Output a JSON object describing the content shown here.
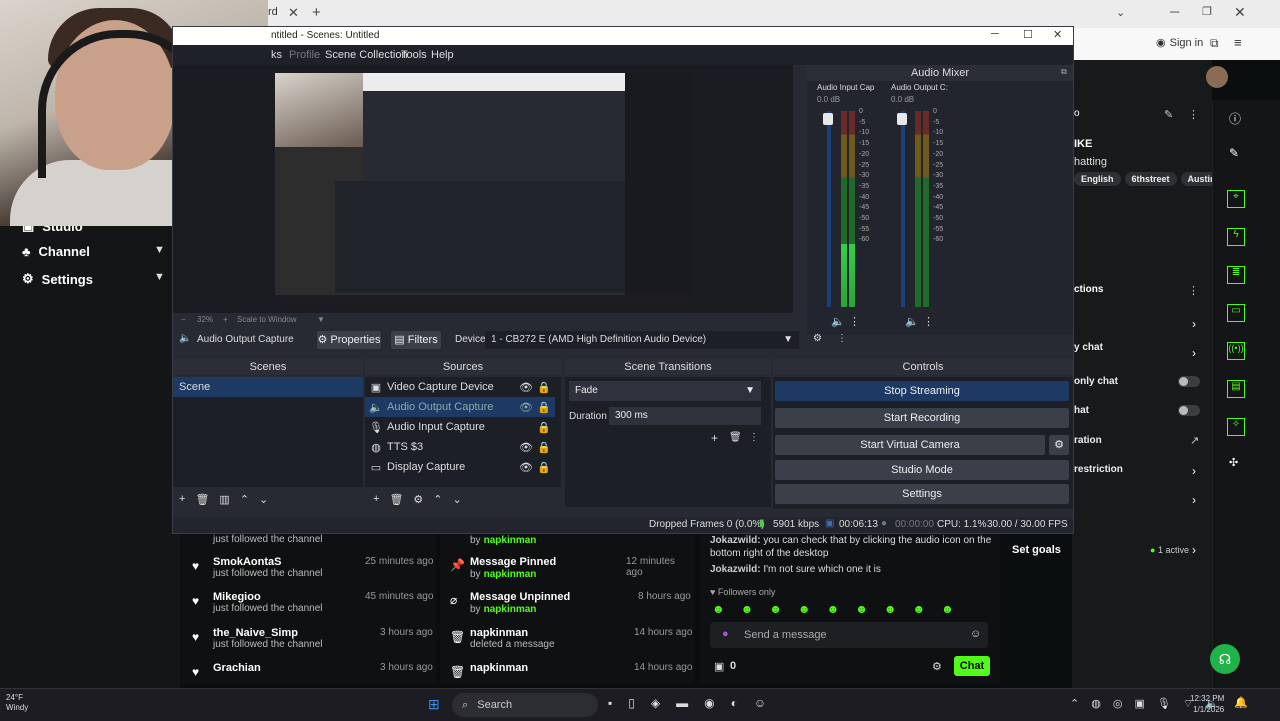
{
  "browser": {
    "signin": "Sign in",
    "tab_title": "rd"
  },
  "kick_left": {
    "items": [
      {
        "label": "Studio"
      },
      {
        "label": "Channel"
      },
      {
        "label": "Settings"
      }
    ]
  },
  "kick_right": {
    "title_partial": "IKE",
    "sub_partial": "hatting",
    "tags": [
      "English",
      "6thstreet",
      "Austin"
    ],
    "section_label": "ctions",
    "rows": [
      "y chat",
      "only chat",
      "hat",
      "ration",
      "restriction"
    ],
    "goals_label": "Set goals",
    "goals_status": "1 active"
  },
  "obs": {
    "title": "ntitled - Scenes: Untitled",
    "menu": [
      "ks",
      "Profile",
      "Scene Collection",
      "Tools",
      "Help"
    ],
    "zoom": "32%",
    "scale_label": "Scale to Window",
    "source_bar": {
      "selected_source": "Audio Output Capture",
      "properties": "Properties",
      "filters": "Filters",
      "device_label": "Device",
      "device_value": "1 - CB272 E (AMD High Definition Audio Device)"
    },
    "mixer": {
      "title": "Audio Mixer",
      "channels": [
        {
          "name": "Audio Input Cap",
          "db": "0.0 dB",
          "level": 0.32
        },
        {
          "name": "Audio Output C:",
          "db": "0.0 dB",
          "level": 0.0
        }
      ],
      "scale": [
        "0",
        "-5",
        "-10",
        "-15",
        "-20",
        "-25",
        "-30",
        "-35",
        "-40",
        "-45",
        "-50",
        "-55",
        "-60"
      ]
    },
    "scenes": {
      "title": "Scenes",
      "items": [
        "Scene"
      ]
    },
    "sources": {
      "title": "Sources",
      "items": [
        "Video Capture Device",
        "Audio Output Capture",
        "Audio Input Capture",
        "TTS $3",
        "Display Capture"
      ]
    },
    "transitions": {
      "title": "Scene Transitions",
      "type": "Fade",
      "duration_label": "Duration",
      "duration_value": "300 ms"
    },
    "controls": {
      "title": "Controls",
      "buttons": [
        "Stop Streaming",
        "Start Recording",
        "Start Virtual Camera",
        "Studio Mode",
        "Settings"
      ]
    },
    "status": {
      "dropped": "Dropped Frames 0 (0.0%)",
      "kbps": "5901 kbps",
      "stream_time": "00:06:13",
      "rec_time": "00:00:00",
      "cpu": "CPU: 1.1%",
      "fps": "30.00 / 30.00 FPS"
    }
  },
  "feed_left": [
    {
      "name": "",
      "sub": "just followed the channel",
      "time": ""
    },
    {
      "name": "SmokAontaS",
      "sub": "just followed the channel",
      "time": "25 minutes ago"
    },
    {
      "name": "Mikegioo",
      "sub": "just followed the channel",
      "time": "45 minutes ago"
    },
    {
      "name": "the_Naive_Simp",
      "sub": "just followed the channel",
      "time": "3 hours ago"
    },
    {
      "name": "Grachian",
      "sub": "just followed the channel",
      "time": "3 hours ago"
    }
  ],
  "feed_mid": [
    {
      "name": "",
      "by": "by",
      "who": "napkinman",
      "time": ""
    },
    {
      "name": "Message Pinned",
      "by": "by",
      "who": "napkinman",
      "time": "12 minutes ago"
    },
    {
      "name": "Message Unpinned",
      "by": "by",
      "who": "napkinman",
      "time": "8 hours ago"
    },
    {
      "name": "napkinman",
      "by": "",
      "who": "deleted a message",
      "time": "14 hours ago"
    },
    {
      "name": "napkinman",
      "by": "",
      "who": "",
      "time": "14 hours ago"
    }
  ],
  "chat": {
    "messages": [
      {
        "user": "Jokazwild:",
        "text": " you can check that by clicking the audio icon on the bottom right of the desktop"
      },
      {
        "user": "Jokazwild:",
        "text": " I'm not sure which one it is"
      }
    ],
    "followers_only": "Followers only",
    "placeholder": "Send a message",
    "count": "0",
    "chat_button": "Chat"
  },
  "taskbar": {
    "weather_temp": "24°F",
    "weather_desc": "Windy",
    "search": "Search",
    "time": "12:32 PM",
    "date": "1/1/2026"
  },
  "colors": {
    "kick_green": "#53fc18",
    "obs_bg": "#272a33",
    "obs_accent": "#1c3a63"
  }
}
